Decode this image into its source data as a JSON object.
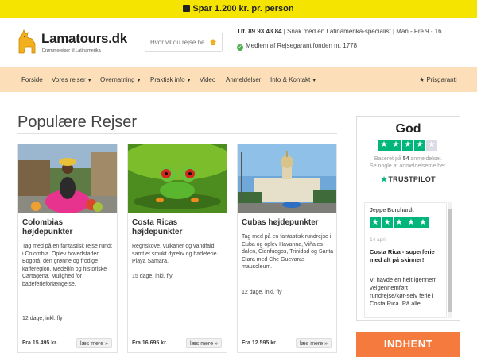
{
  "promo": {
    "text": "Spar 1.200 kr. pr. person",
    "icon": "gift-icon"
  },
  "header": {
    "logo_text": "Lamatours.dk",
    "logo_sub": "Drømmerejser til Latinamerika",
    "search_placeholder": "Hvor vil du rejse hen?",
    "phone": "Tlf. 89 93 43 84",
    "contact_rest": " | Snak med en Latinamerika-specialist | Man - Fre 9 - 16",
    "membership": "Medlem af Rejsegarantifonden nr. 1778"
  },
  "nav": {
    "items": [
      {
        "label": "Forside",
        "dropdown": false
      },
      {
        "label": "Vores rejser",
        "dropdown": true
      },
      {
        "label": "Overnatning",
        "dropdown": true
      },
      {
        "label": "Praktisk info",
        "dropdown": true
      },
      {
        "label": "Video",
        "dropdown": false
      },
      {
        "label": "Anmeldelser",
        "dropdown": false
      },
      {
        "label": "Info & Kontakt",
        "dropdown": true
      }
    ],
    "prisgaranti": "★ Prisgaranti"
  },
  "section_title": "Populære Rejser",
  "cards": [
    {
      "title": "Colombias højdepunkter",
      "description": "Tag med på en fantastisk rejse rundt i Colombia. Oplev hovedstaden Bogotá, den grønne og frodige kafferegion, Medellín og historiske Cartagena. Mulighed for badeferieforlængelse.",
      "days": "12 dage, inkl. fly",
      "price": "Fra 15.495 kr.",
      "more": "læs mere »"
    },
    {
      "title": "Costa Ricas højdepunkter",
      "description": "Regnskove, vulkaner og vandfald samt et smukt dyreliv og badeferie i Playa Samara.",
      "days": "15 dage, inkl. fly",
      "price": "Fra 16.695 kr.",
      "more": "læs mere »"
    },
    {
      "title": "Cubas højdepunkter",
      "description": "Tag med på en fantastisk rundrejse i Cuba og oplev Havanna, Viñales-dalen, Cienfuegos, Trinidad og Santa Clara med Che Guevaras mausoleum.",
      "days": "12 dage, inkl. fly",
      "price": "Fra 12.595 kr.",
      "more": "læs mere »"
    }
  ],
  "trustpilot": {
    "rating_word": "God",
    "stars_filled": 4,
    "stars_total": 5,
    "based_prefix": "Baseret på ",
    "review_count": "54",
    "based_suffix": " anmeldelser.",
    "based_line2": "Se nogle af anmeldelserne her.",
    "logo": "TRUSTPILOT",
    "review": {
      "name": "Jeppe Burchardt",
      "stars": 5,
      "date": "14 april",
      "title": "Costa Rica - superferie med alt på skinner!",
      "body": "Vi havde en helt igennem velgennemført rundrejse/kør-selv ferie i Costa Rica. På alle"
    }
  },
  "cta_label": "INDHENT",
  "colors": {
    "promo": "#f5e400",
    "nav": "#fcdfb8",
    "trustpilot": "#00b67a",
    "cta": "#f47a3e"
  }
}
